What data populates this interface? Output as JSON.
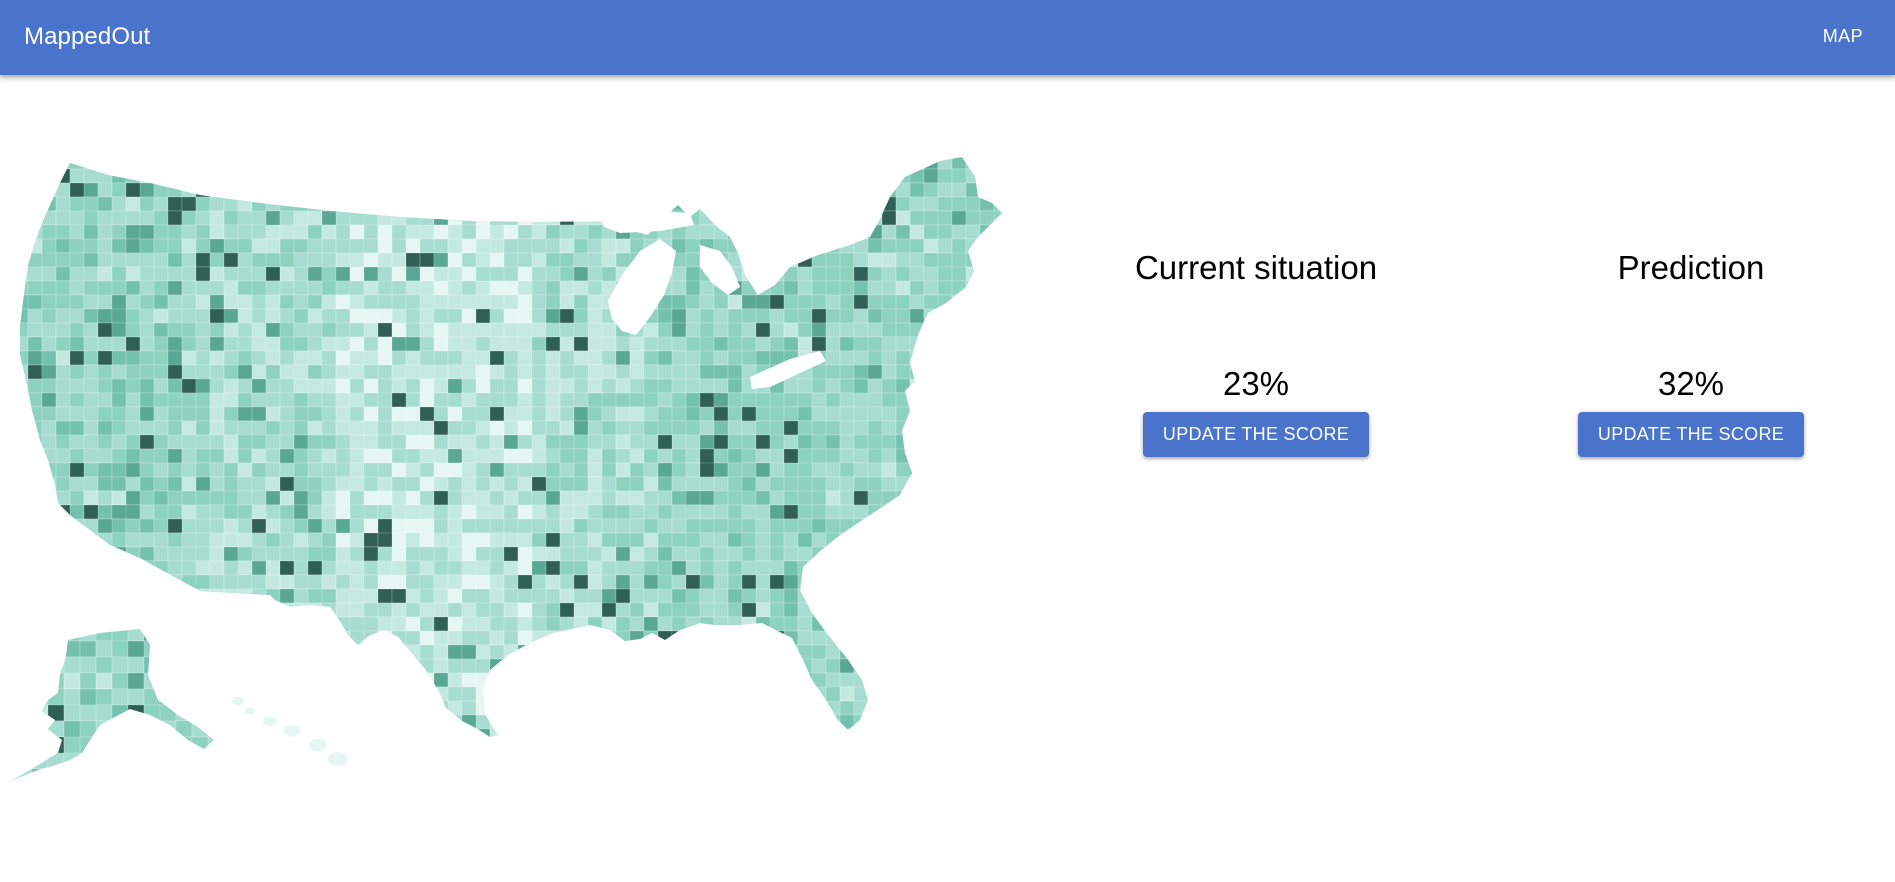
{
  "appbar": {
    "brand": "MappedOut",
    "nav_map": "MAP",
    "color": "#4a74cb"
  },
  "map": {
    "icon": "us-county-choropleth-map",
    "palette": [
      "#e6f6f2",
      "#c4e9e0",
      "#a6ddd0",
      "#8dd1bf",
      "#74c2ad",
      "#5aa794",
      "#2f5f55"
    ],
    "background": "#ffffff"
  },
  "current": {
    "title": "Current situation",
    "value": "23%",
    "button_label": "UPDATE THE SCORE"
  },
  "prediction": {
    "title": "Prediction",
    "value": "32%",
    "button_label": "UPDATE THE SCORE"
  }
}
